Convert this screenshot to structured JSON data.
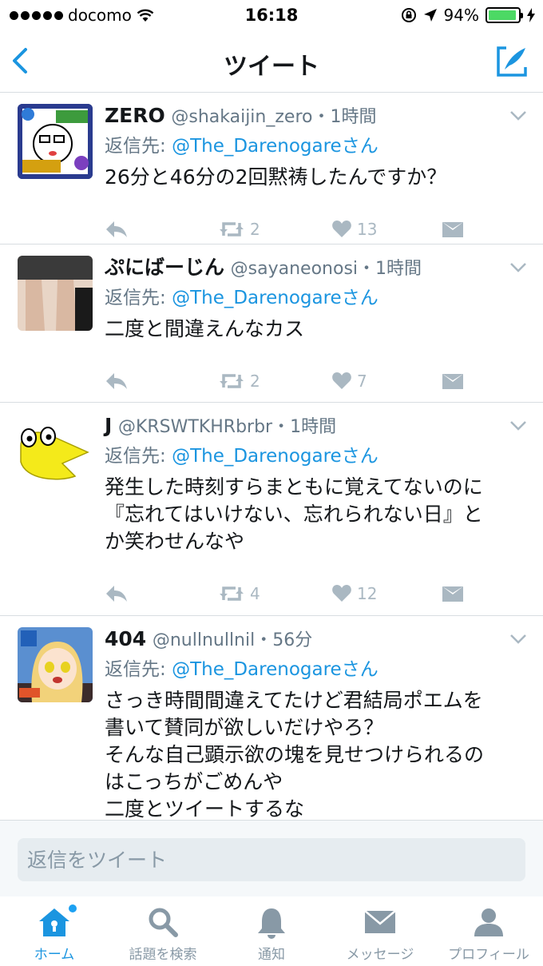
{
  "status": {
    "carrier": "docomo",
    "time": "16:18",
    "battery": "94%",
    "battery_level": 0.94,
    "signal_dots": 5
  },
  "nav": {
    "title": "ツイート",
    "back_icon": "chevron-left-icon",
    "compose_icon": "compose-icon"
  },
  "reply_prefix": "返信先: ",
  "tweets": [
    {
      "name": "ZERO",
      "handle": "@shakaijin_zero",
      "time": "・1時間",
      "reply_to": "@The_Darenogareさん",
      "text": "26分と46分の2回黙祷したんですか？",
      "retweets": "2",
      "likes": "13"
    },
    {
      "name": "ぷにばーじん",
      "handle": "@sayaneonosi",
      "time": "・1時間",
      "reply_to": "@The_Darenogareさん",
      "text": "二度と間違えんなカス",
      "retweets": "2",
      "likes": "7"
    },
    {
      "name": "J",
      "handle": "@KRSWTKHRbrbr",
      "time": "・1時間",
      "reply_to": "@The_Darenogareさん",
      "text_lines": [
        "発生した時刻すらまともに覚えてないのに",
        "『忘れてはいけない、忘れられない日』と",
        "か笑わせんなや"
      ],
      "retweets": "4",
      "likes": "12"
    },
    {
      "name": "404",
      "handle": "@nullnullnil",
      "time": "・56分",
      "reply_to": "@The_Darenogareさん",
      "text_lines": [
        "さっき時間間違えてたけど君結局ポエムを",
        "書いて賛同が欲しいだけやろ？",
        "そんな自己顕示欲の塊を見せつけられるの",
        "はこっちがごめんや",
        "二度とツイートするな"
      ]
    }
  ],
  "reply_box": {
    "placeholder": "返信をツイート"
  },
  "tabs": [
    {
      "label": "ホーム",
      "icon": "home-icon",
      "active": true
    },
    {
      "label": "話題を検索",
      "icon": "search-icon"
    },
    {
      "label": "通知",
      "icon": "bell-icon"
    },
    {
      "label": "メッセージ",
      "icon": "envelope-icon"
    },
    {
      "label": "プロフィール",
      "icon": "profile-icon"
    }
  ],
  "colors": {
    "accent": "#1b95e0",
    "secondary_text": "#657786",
    "action_icon": "#aab8c2",
    "battery": "#4cd964"
  }
}
